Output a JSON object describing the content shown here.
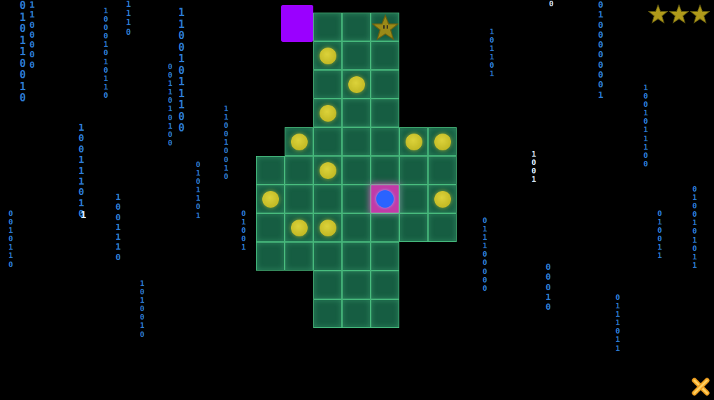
{
  "rain": [
    {
      "text": "010110010",
      "bright": false
    },
    {
      "text": "1100000",
      "bright": false
    },
    {
      "text": "1110",
      "bright": false
    },
    {
      "text": "100111010",
      "bright": false
    },
    {
      "text": "1",
      "bright": true
    },
    {
      "text": "10001010110",
      "bright": false
    },
    {
      "text": "1001110",
      "bright": false
    },
    {
      "text": "0011010100",
      "bright": false
    },
    {
      "text": "11001011100",
      "bright": false
    },
    {
      "text": "0101101",
      "bright": false
    },
    {
      "text": "110010010",
      "bright": false
    },
    {
      "text": "01001",
      "bright": false
    },
    {
      "text": "0010110",
      "bright": false
    },
    {
      "text": "0100000001",
      "bright": false
    },
    {
      "text": "0",
      "bright": true
    },
    {
      "text": "1001011100",
      "bright": false
    },
    {
      "text": "00010",
      "bright": false
    },
    {
      "text": "101101",
      "bright": false
    },
    {
      "text": "011100000",
      "bright": false
    },
    {
      "text": "0100101011",
      "bright": false
    },
    {
      "text": "1001",
      "bright": true
    },
    {
      "text": "010011",
      "bright": false
    },
    {
      "text": "0111011",
      "bright": false
    },
    {
      "text": "1010010",
      "bright": false
    }
  ],
  "board": [
    [
      "empty",
      "empty",
      "floor",
      "floor",
      "star",
      "empty",
      "empty"
    ],
    [
      "empty",
      "empty",
      "dot",
      "floor",
      "floor",
      "empty",
      "empty"
    ],
    [
      "empty",
      "empty",
      "floor",
      "dot",
      "floor",
      "empty",
      "empty"
    ],
    [
      "empty",
      "empty",
      "dot",
      "floor",
      "floor",
      "empty",
      "empty"
    ],
    [
      "empty",
      "dot",
      "floor",
      "floor",
      "floor",
      "dot",
      "dot"
    ],
    [
      "floor",
      "floor",
      "dot",
      "floor",
      "floor",
      "floor",
      "floor"
    ],
    [
      "dot",
      "floor",
      "floor",
      "floor",
      "player",
      "floor",
      "dot"
    ],
    [
      "floor",
      "dot",
      "dot",
      "floor",
      "floor",
      "floor",
      "floor"
    ],
    [
      "floor",
      "floor",
      "floor",
      "floor",
      "floor",
      "empty",
      "empty"
    ],
    [
      "empty",
      "empty",
      "floor",
      "floor",
      "floor",
      "empty",
      "empty"
    ],
    [
      "empty",
      "empty",
      "floor",
      "floor",
      "floor",
      "empty",
      "empty"
    ]
  ],
  "rating": {
    "stars": 3,
    "total": 3
  }
}
